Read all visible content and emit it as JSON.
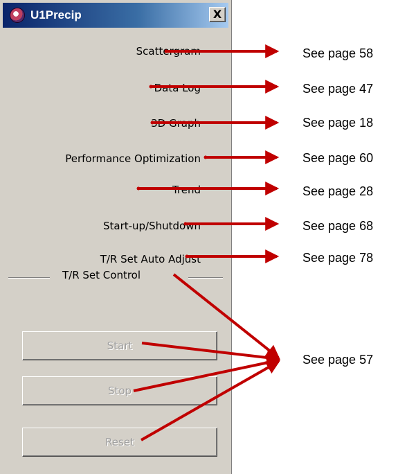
{
  "window": {
    "title": "U1Precip",
    "close_label": "X"
  },
  "menu": {
    "items": [
      {
        "label": "Scattergram"
      },
      {
        "label": "Data Log"
      },
      {
        "label": "3D Graph"
      },
      {
        "label": "Performance Optimization"
      },
      {
        "label": "Trend"
      },
      {
        "label": "Start-up/Shutdown"
      },
      {
        "label": "T/R Set Auto Adjust"
      }
    ]
  },
  "control_group": {
    "label": "T/R Set Control",
    "buttons": [
      {
        "label": "Start",
        "enabled": false
      },
      {
        "label": "Stop",
        "enabled": false
      },
      {
        "label": "Reset",
        "enabled": false
      }
    ]
  },
  "annotations": [
    {
      "text": "See page 58"
    },
    {
      "text": "See page 47"
    },
    {
      "text": "See page 18"
    },
    {
      "text": "See page 60"
    },
    {
      "text": "See page 28"
    },
    {
      "text": "See page 68"
    },
    {
      "text": "See page 78"
    },
    {
      "text": "See page 57"
    }
  ],
  "colors": {
    "window_bg": "#d4d0c8",
    "titlebar_start": "#0a246a",
    "titlebar_end": "#a6caf0",
    "arrow": "#c00000"
  }
}
